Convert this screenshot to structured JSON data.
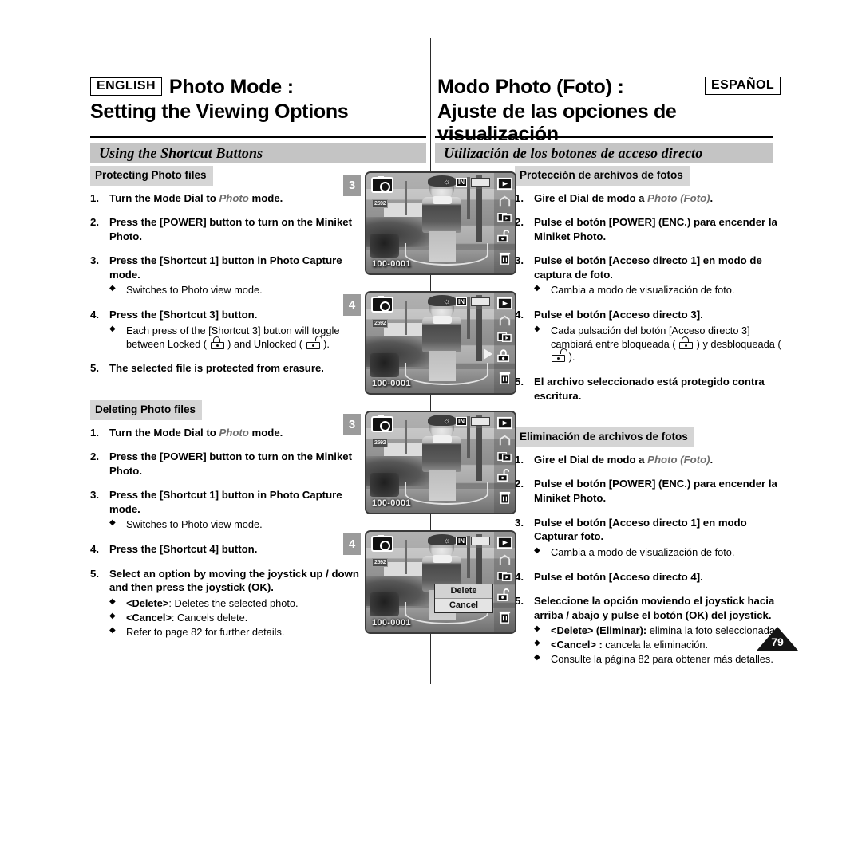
{
  "header": {
    "english_tag": "ENGLISH",
    "spanish_tag": "ESPAÑOL",
    "en_title_line1": "Photo Mode :",
    "en_title_line2": "Setting the Viewing Options",
    "es_title_line1": "Modo Photo (Foto) :",
    "es_title_line2": "Ajuste de las opciones de visualización",
    "en_band": "Using the Shortcut Buttons",
    "es_band": "Utilización de los botones de acceso directo"
  },
  "english": {
    "protect": {
      "subhead": "Protecting Photo files",
      "steps": [
        {
          "num": "1.",
          "pre": "Turn the Mode Dial to ",
          "em": "Photo",
          "post": " mode.",
          "bullets": []
        },
        {
          "num": "2.",
          "text": "Press the [POWER] button to turn on the Miniket Photo.",
          "bullets": []
        },
        {
          "num": "3.",
          "text": "Press the [Shortcut 1] button in Photo Capture mode.",
          "bullets": [
            "Switches to Photo view mode."
          ]
        },
        {
          "num": "4.",
          "text": "Press the [Shortcut 3] button.",
          "bullets": []
        },
        {
          "num": "5.",
          "text": "The selected file is protected from erasure.",
          "bullets": []
        }
      ],
      "lock_bullet_pre": "Each press of the [Shortcut 3] button will toggle between Locked (",
      "lock_bullet_mid": ") and Unlocked (",
      "lock_bullet_post": ")."
    },
    "delete": {
      "subhead": "Deleting Photo files",
      "steps": [
        {
          "num": "1.",
          "pre": "Turn the Mode Dial to ",
          "em": "Photo",
          "post": " mode.",
          "bullets": []
        },
        {
          "num": "2.",
          "text": "Press the [POWER] button to turn on the Miniket Photo.",
          "bullets": []
        },
        {
          "num": "3.",
          "text": "Press the [Shortcut 1] button in Photo Capture mode.",
          "bullets": [
            "Switches to Photo view mode."
          ]
        },
        {
          "num": "4.",
          "text": "Press the [Shortcut 4] button.",
          "bullets": []
        },
        {
          "num": "5.",
          "text": "Select an option by moving the joystick up / down and then press the joystick (OK).",
          "bullets": []
        }
      ],
      "option_delete_label": "<Delete>",
      "option_delete_text": ": Deletes the selected photo.",
      "option_cancel_label": "<Cancel>",
      "option_cancel_text": ": Cancels delete.",
      "option_refer": "Refer to page 82 for further details."
    }
  },
  "spanish": {
    "protect": {
      "subhead": "Protección de archivos de fotos",
      "steps": [
        {
          "num": "1.",
          "pre": "Gire el Dial de modo a ",
          "em": "Photo (Foto)",
          "post": ".",
          "bullets": []
        },
        {
          "num": "2.",
          "text": "Pulse el botón [POWER] (ENC.) para encender la Miniket Photo.",
          "bullets": []
        },
        {
          "num": "3.",
          "text": "Pulse el botón [Acceso directo 1] en modo de captura de foto.",
          "bullets": [
            "Cambia a modo de visualización de foto."
          ]
        },
        {
          "num": "4.",
          "text": "Pulse el botón [Acceso directo 3].",
          "bullets": []
        },
        {
          "num": "5.",
          "text": "El archivo seleccionado está protegido contra escritura.",
          "bullets": []
        }
      ],
      "lock_bullet_pre": "Cada pulsación del botón [Acceso directo 3] cambiará entre bloqueada (",
      "lock_bullet_mid": ") y desbloqueada (",
      "lock_bullet_post": ")."
    },
    "delete": {
      "subhead": "Eliminación de archivos de fotos",
      "steps": [
        {
          "num": "1.",
          "pre": "Gire el Dial de modo a ",
          "em": "Photo (Foto)",
          "post": ".",
          "bullets": []
        },
        {
          "num": "2.",
          "text": "Pulse el botón [POWER] (ENC.) para encender la Miniket Photo.",
          "bullets": []
        },
        {
          "num": "3.",
          "text": "Pulse el botón [Acceso directo 1] en modo Capturar foto.",
          "bullets": [
            "Cambia a modo de visualización de foto."
          ]
        },
        {
          "num": "4.",
          "text": "Pulse el botón [Acceso directo 4].",
          "bullets": []
        },
        {
          "num": "5.",
          "text": "Seleccione la opción moviendo el joystick hacia arriba / abajo y pulse el botón (OK) del joystick.",
          "bullets": []
        }
      ],
      "option_delete_label": "<Delete> (Eliminar):",
      "option_delete_text": " elimina la foto seleccionada.",
      "option_cancel_label": "<Cancel> :",
      "option_cancel_text": " cancela la eliminación.",
      "option_refer": "Consulte la página 82 para obtener más detalles."
    }
  },
  "screenshots": [
    {
      "step": "3",
      "filename": "100-0001",
      "resolution": "2592",
      "in_badge": "IN",
      "lock_state": "unlocked",
      "popup": false
    },
    {
      "step": "4",
      "filename": "100-0001",
      "resolution": "2592",
      "in_badge": "IN",
      "lock_state": "locked",
      "popup": false
    },
    {
      "step": "3",
      "filename": "100-0001",
      "resolution": "2592",
      "in_badge": "IN",
      "lock_state": "unlocked",
      "popup": false
    },
    {
      "step": "4",
      "filename": "100-0001",
      "resolution": "2592",
      "in_badge": "IN",
      "lock_state": "unlocked",
      "popup": true
    }
  ],
  "popup_menu": {
    "delete": "Delete",
    "cancel": "Cancel"
  },
  "page_number": "79"
}
